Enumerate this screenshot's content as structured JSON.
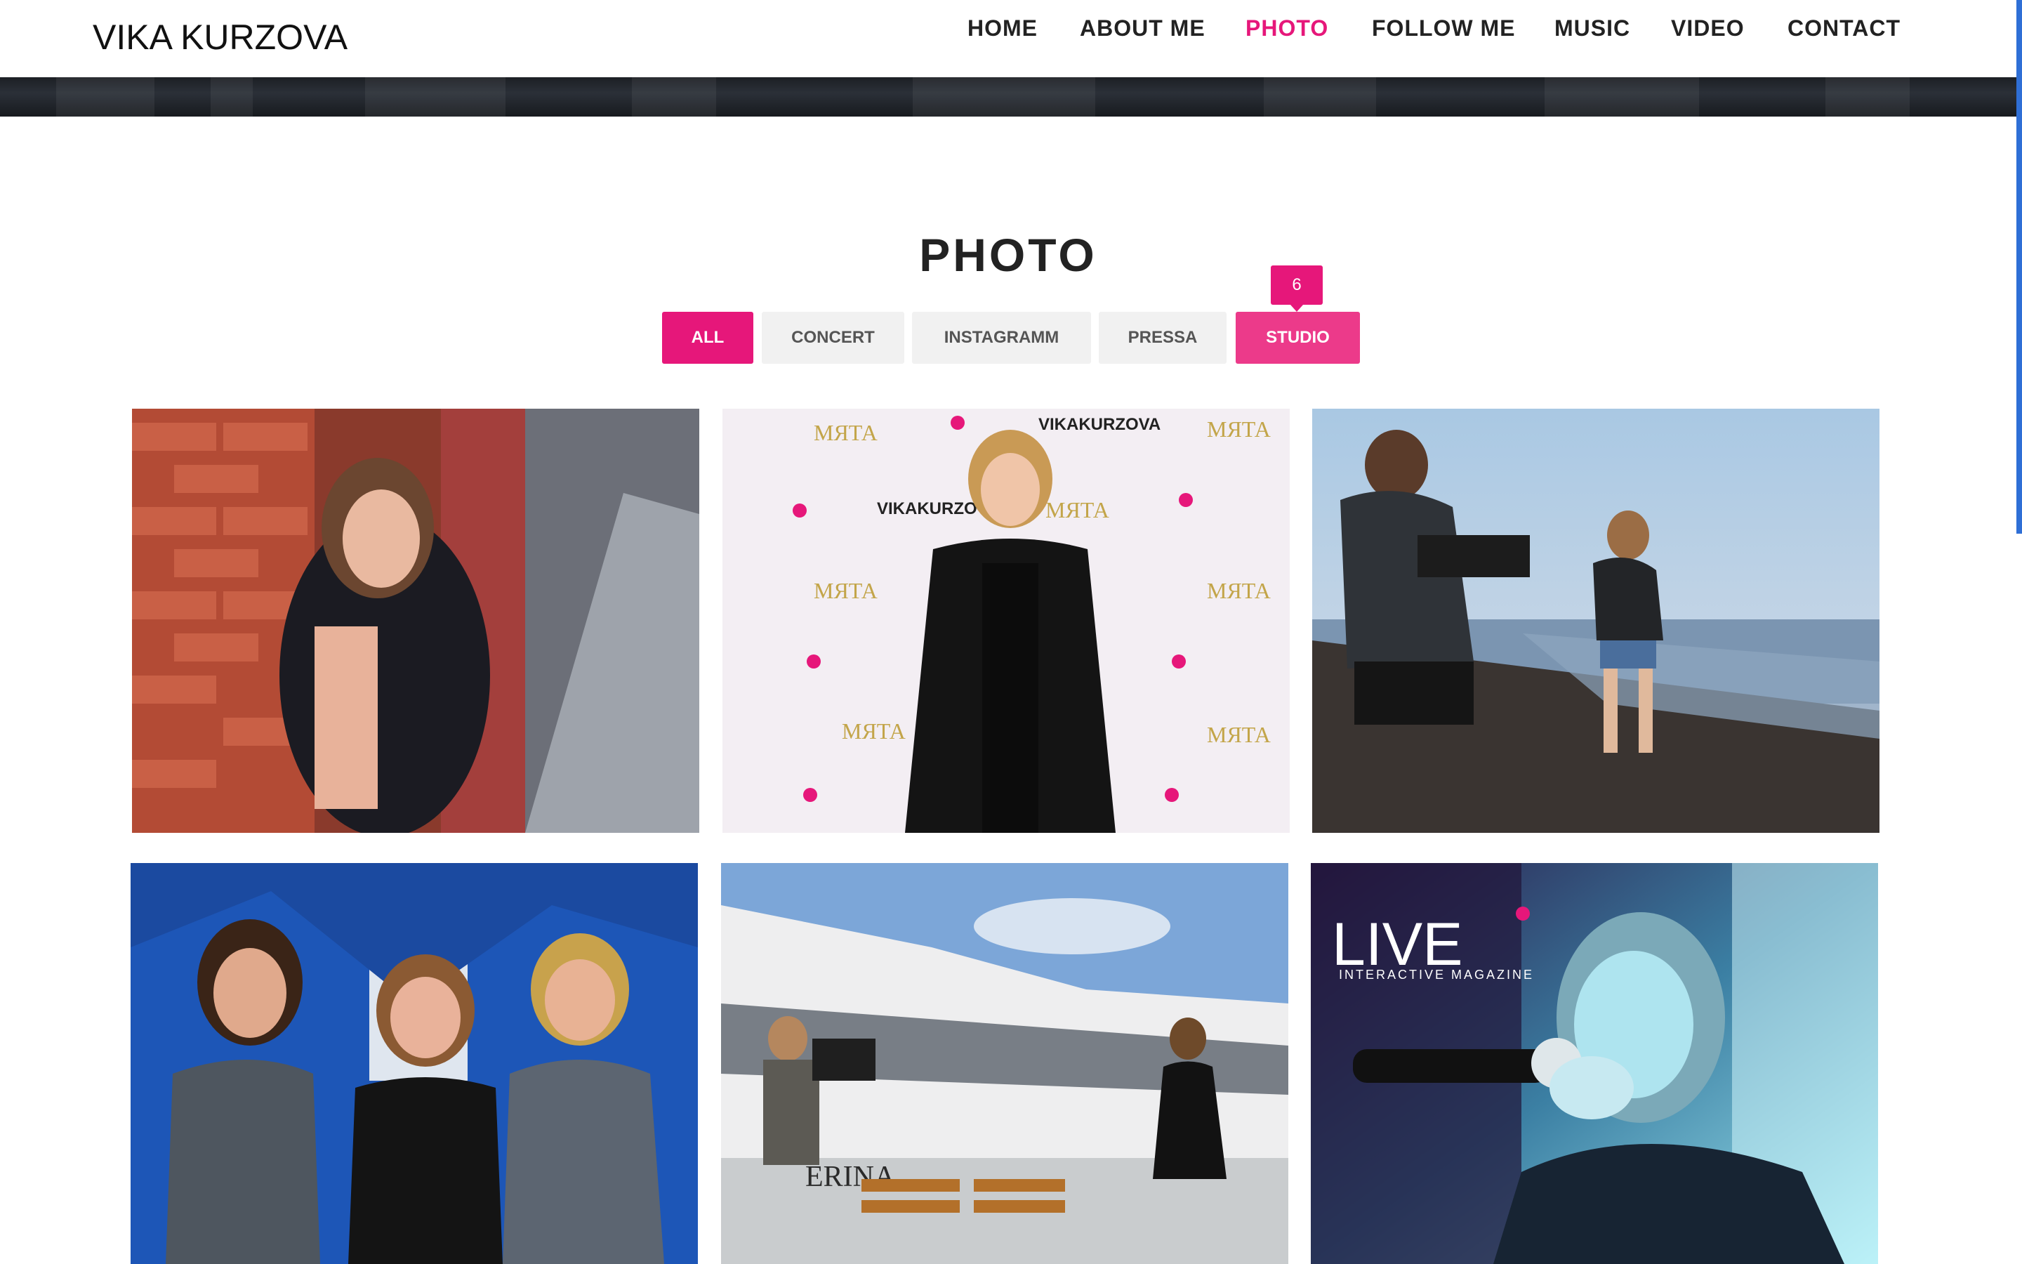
{
  "header": {
    "logo": "VIKA KURZOVA",
    "nav": [
      {
        "label": "HOME",
        "active": false
      },
      {
        "label": "ABOUT ME",
        "active": false
      },
      {
        "label": "PHOTO",
        "active": true
      },
      {
        "label": "FOLLOW ME",
        "active": false
      },
      {
        "label": "MUSIC",
        "active": false
      },
      {
        "label": "VIDEO",
        "active": false
      },
      {
        "label": "CONTACT",
        "active": false
      }
    ]
  },
  "section": {
    "title": "PHOTO"
  },
  "filters": {
    "items": [
      {
        "label": "ALL",
        "state": "selected"
      },
      {
        "label": "CONCERT",
        "state": "normal"
      },
      {
        "label": "INSTAGRAMM",
        "state": "normal"
      },
      {
        "label": "PRESSA",
        "state": "normal"
      },
      {
        "label": "STUDIO",
        "state": "hover"
      }
    ],
    "hover_count": "6"
  },
  "gallery": {
    "backdrop_logo_1": "VIKAKURZOVA",
    "backdrop_logo_2": "МЯТА",
    "magazine_logo": "LIVE",
    "magazine_tagline": "INTERACTIVE MAGAZINE",
    "boat_name": "ERINA"
  },
  "colors": {
    "accent": "#e6177a",
    "text": "#222222",
    "filter_bg": "#f1f1f1",
    "scrollbar": "#2f6fd6"
  }
}
